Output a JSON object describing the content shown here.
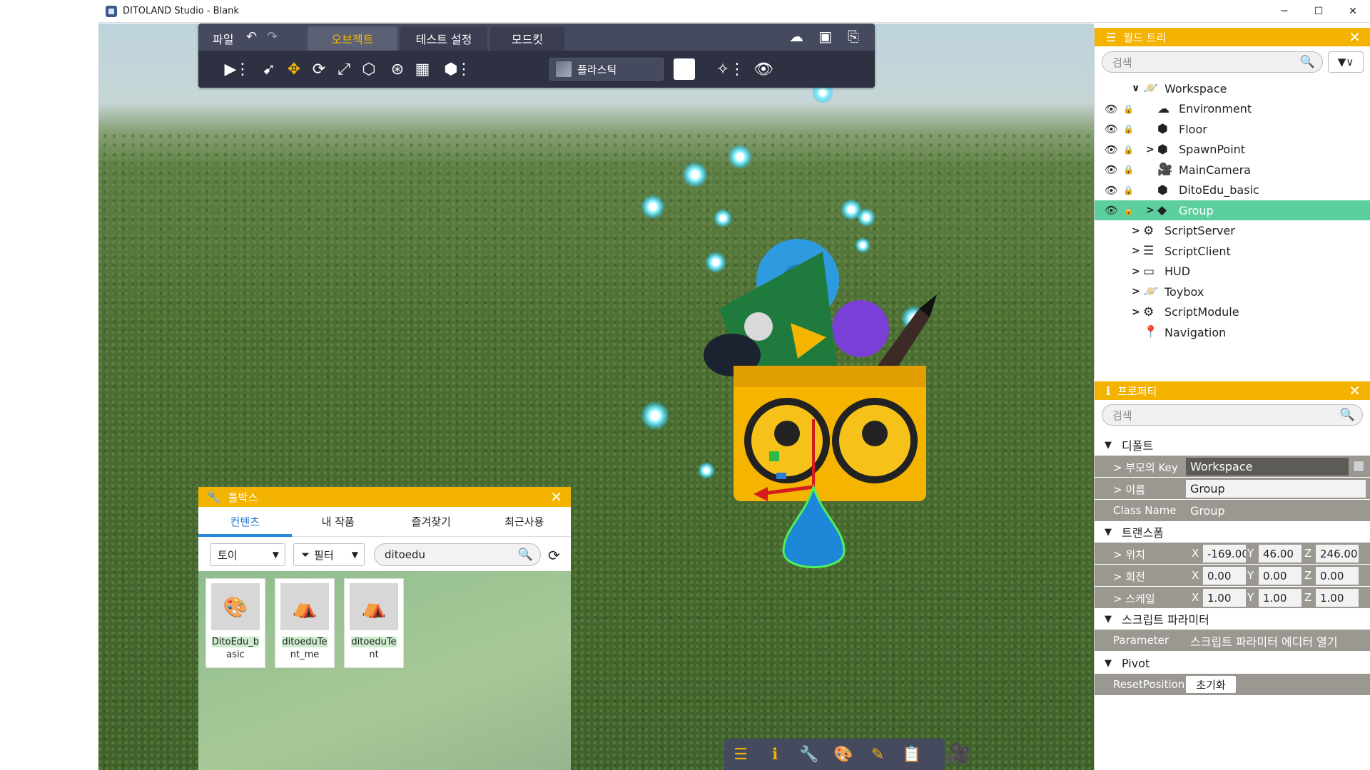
{
  "window": {
    "title": "DITOLAND Studio - Blank",
    "controls": {
      "minimize": "─",
      "maximize": "☐",
      "close": "✕"
    }
  },
  "topbar": {
    "file_menu": "파일",
    "undo": "↶",
    "redo": "↷",
    "tabs": [
      {
        "label": "오브젝트",
        "active": true
      },
      {
        "label": "테스트 설정",
        "active": false
      },
      {
        "label": "모드킷",
        "active": false
      }
    ],
    "icons": {
      "upload": "☁",
      "save": "▣",
      "export": "⎘"
    },
    "tools": {
      "play": "▶",
      "more1": "⋮",
      "select": "➹",
      "move": "✥",
      "rotate": "⟳",
      "scale": "⤢",
      "transform": "⬡",
      "physics": "⊛",
      "grid": "▦",
      "part": "⬢",
      "more2": "⋮",
      "effects": "✧",
      "more3": "⋮",
      "visibility": "👁"
    },
    "material_label": "플라스틱",
    "color_value": "#ffffff"
  },
  "toolbox": {
    "title": "툴박스",
    "close": "✕",
    "tabs": [
      {
        "label": "컨텐츠",
        "active": true
      },
      {
        "label": "내 작품",
        "active": false
      },
      {
        "label": "즐겨찾기",
        "active": false
      },
      {
        "label": "최근사용",
        "active": false
      }
    ],
    "category": "토이",
    "filter_label": "필터",
    "search_value": "ditoedu",
    "items": [
      {
        "name_line1": "DitoEdu_b",
        "name_line2": "asic",
        "icon": "🎨"
      },
      {
        "name_line1": "ditoeduTe",
        "name_line2": "nt_me",
        "icon": "⛺"
      },
      {
        "name_line1": "ditoeduTe",
        "name_line2": "nt",
        "icon": "⛺"
      }
    ]
  },
  "panel_switch": {
    "icons": [
      "☰",
      "ℹ",
      "🔧",
      "🎨",
      "✎",
      "📋"
    ],
    "camera": "🎥"
  },
  "worldtree": {
    "title": "월드 트리",
    "close": "✕",
    "search_placeholder": "검색",
    "filter": "▼∨",
    "nodes": [
      {
        "label": "Workspace",
        "depth": 0,
        "expanded": true,
        "icon": "🪐",
        "eye": false
      },
      {
        "label": "Environment",
        "depth": 1,
        "icon": "☁",
        "eye": true,
        "lock": false
      },
      {
        "label": "Floor",
        "depth": 1,
        "icon": "⬢",
        "eye": true,
        "lock": true
      },
      {
        "label": "SpawnPoint",
        "depth": 1,
        "icon": "⬢",
        "eye": true,
        "lock": false,
        "collapsed": true
      },
      {
        "label": "MainCamera",
        "depth": 1,
        "icon": "🎥",
        "eye": true,
        "lock": false
      },
      {
        "label": "DitoEdu_basic",
        "depth": 1,
        "icon": "⬢",
        "eye": true,
        "lock": false
      },
      {
        "label": "Group",
        "depth": 1,
        "icon": "◆",
        "eye": true,
        "lock": false,
        "collapsed": true,
        "selected": true
      },
      {
        "label": "ScriptServer",
        "depth": 0,
        "icon": "⚙",
        "collapsed": true
      },
      {
        "label": "ScriptClient",
        "depth": 0,
        "icon": "☰",
        "collapsed": true
      },
      {
        "label": "HUD",
        "depth": 0,
        "icon": "▭",
        "collapsed": true
      },
      {
        "label": "Toybox",
        "depth": 0,
        "icon": "🪐",
        "collapsed": true
      },
      {
        "label": "ScriptModule",
        "depth": 0,
        "icon": "⚙",
        "collapsed": true
      },
      {
        "label": "Navigation",
        "depth": 0,
        "icon": "📍"
      }
    ]
  },
  "properties": {
    "title": "프로퍼티",
    "close": "✕",
    "search_placeholder": "검색",
    "sections": {
      "default": "디폴트",
      "transform": "트랜스폼",
      "script_params": "스크립트 파라미터",
      "pivot": "Pivot"
    },
    "parent_key_label": "> 부모의 Key",
    "parent_key_value": "Workspace",
    "name_label": "> 이름",
    "name_value": "Group",
    "class_label": "Class Name",
    "class_value": "Group",
    "position_label": "> 위치",
    "position": {
      "x": "-169.00",
      "y": "46.00",
      "z": "246.00"
    },
    "rotation_label": "> 회전",
    "rotation": {
      "x": "0.00",
      "y": "0.00",
      "z": "0.00"
    },
    "scale_label": "> 스케일",
    "scale": {
      "x": "1.00",
      "y": "1.00",
      "z": "1.00"
    },
    "axis": {
      "x": "X",
      "y": "Y",
      "z": "Z"
    },
    "parameter_label": "Parameter",
    "parameter_value": "스크립트 파라미터 에디터 열기",
    "reset_label": "ResetPosition",
    "reset_button": "초기화"
  }
}
